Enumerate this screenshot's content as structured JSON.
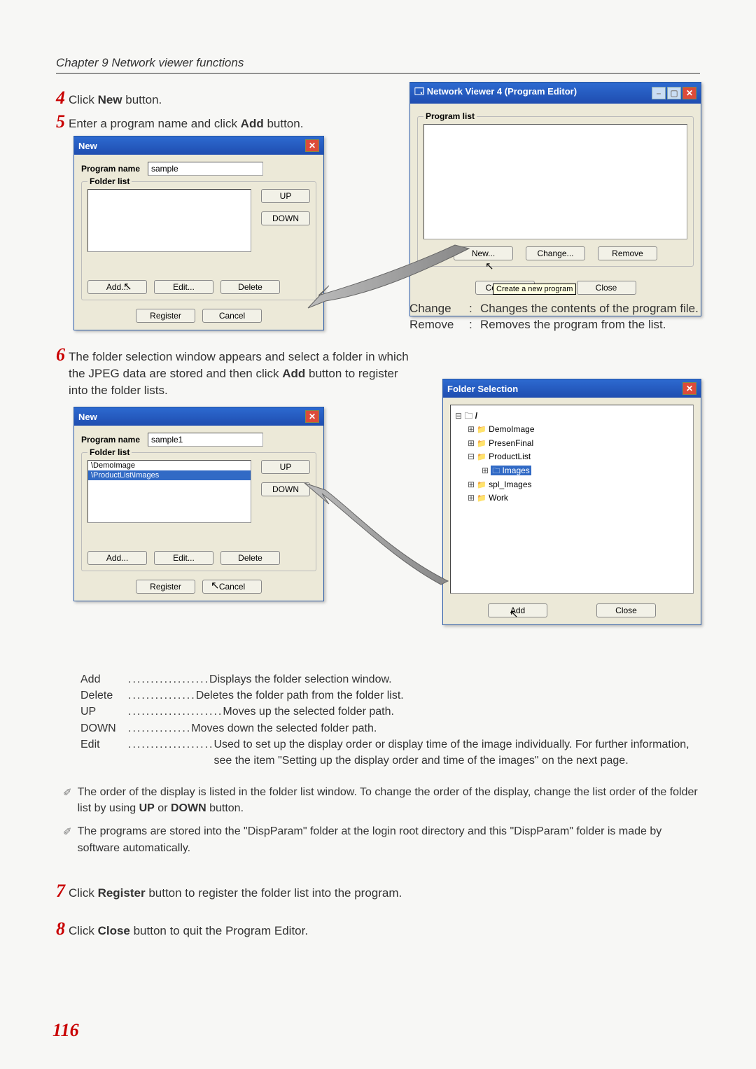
{
  "page": {
    "chapter_header": "Chapter 9 Network viewer functions",
    "page_number": "116"
  },
  "steps": {
    "s4": {
      "num": "4",
      "text_a": "Click ",
      "bold": "New",
      "text_b": " button."
    },
    "s5": {
      "num": "5",
      "text_a": "Enter a program name and click ",
      "bold": "Add",
      "text_b": " button."
    },
    "s6": {
      "num": "6",
      "text_a": "The folder selection window appears and select a folder in which the JPEG data are stored and then click ",
      "bold": "Add",
      "text_b": " button to register into the folder lists."
    },
    "s7": {
      "num": "7",
      "text_a": "Click ",
      "bold": "Register",
      "text_b": " button to register the folder list into the program."
    },
    "s8": {
      "num": "8",
      "text_a": "Click ",
      "bold": "Close",
      "text_b": " button to quit the Program Editor."
    }
  },
  "new_dialog_1": {
    "title": "New",
    "program_name_label": "Program name",
    "program_name_value": "sample",
    "folder_list_label": "Folder list",
    "buttons": {
      "up": "UP",
      "down": "DOWN",
      "add": "Add...",
      "edit": "Edit...",
      "delete": "Delete",
      "register": "Register",
      "cancel": "Cancel"
    }
  },
  "new_dialog_2": {
    "title": "New",
    "program_name_label": "Program name",
    "program_name_value": "sample1",
    "folder_list_label": "Folder list",
    "folder_items": [
      "\\DemoImage",
      "\\ProductList\\Images"
    ],
    "buttons": {
      "up": "UP",
      "down": "DOWN",
      "add": "Add...",
      "edit": "Edit...",
      "delete": "Delete",
      "register": "Register",
      "cancel": "Cancel"
    }
  },
  "viewer_dialog": {
    "title": "Network Viewer 4 (Program Editor)",
    "program_list_label": "Program list",
    "buttons": {
      "new": "New...",
      "change": "Change...",
      "remove": "Remove",
      "connect": "Connect...",
      "close": "Close"
    },
    "tooltip": "Create a new program"
  },
  "folder_selection": {
    "title": "Folder Selection",
    "tree": {
      "root": "/",
      "items": [
        "DemoImage",
        "PresenFinal",
        "ProductList",
        "Images",
        "spl_Images",
        "Work"
      ]
    },
    "buttons": {
      "add": "Add",
      "close": "Close"
    }
  },
  "defs": {
    "change": {
      "term": "Change",
      "text_a": "Changes the contents of the program file."
    },
    "remove": {
      "term": "Remove",
      "text_a": "Removes the program from the list."
    }
  },
  "descriptions": [
    {
      "term": "Add",
      "text": "Displays the folder selection window."
    },
    {
      "term": "Delete",
      "text": "Deletes the folder path from the folder list."
    },
    {
      "term": "UP",
      "text": "Moves up the selected folder path."
    },
    {
      "term": "DOWN",
      "text": "Moves down the selected folder path."
    },
    {
      "term": "Edit",
      "text": "Used to set up the display order or display time of the image individually. For further information, see the item \"Setting up the display order and time of the images\" on the next page."
    }
  ],
  "notes": {
    "n1_a": "The order of the display is listed in the folder list window. To change the order of the display, change the list order of the folder list by using ",
    "n1_b": "UP",
    "n1_c": " or ",
    "n1_d": "DOWN",
    "n1_e": " button.",
    "n2": "The programs are stored into the \"DispParam\" folder  at the login root directory and this \"DispParam\" folder is made by software automatically."
  }
}
